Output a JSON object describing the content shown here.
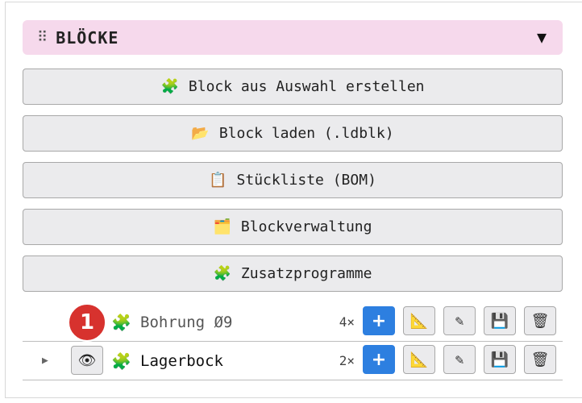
{
  "section": {
    "title": "BLÖCKE",
    "drag_glyph": "⠿",
    "collapse_glyph": "▼"
  },
  "actions": [
    {
      "icon": "🧩",
      "label": "Block aus Auswahl erstellen"
    },
    {
      "icon": "📂",
      "label": "Block laden (.ldblk)"
    },
    {
      "icon": "📋",
      "label": "Stückliste (BOM)"
    },
    {
      "icon": "🗂️",
      "label": "Blockverwaltung"
    },
    {
      "icon": "🧩",
      "label": "Zusatzprogramme"
    }
  ],
  "blocks": [
    {
      "badge": "1",
      "icon": "🧩",
      "name": "Bohrung Ø9",
      "count": "4×"
    },
    {
      "expand_glyph": "▶",
      "eye_glyph": "👁",
      "icon": "🧩",
      "name": "Lagerbock",
      "count": "2×"
    }
  ],
  "row_buttons": {
    "plus": "+",
    "ruler": "📐",
    "edit": "✎",
    "save": "💾",
    "trash": "🗑"
  },
  "colors": {
    "header_bg": "#f6d9ec",
    "primary": "#2d7fe0",
    "badge": "#d7322e"
  }
}
